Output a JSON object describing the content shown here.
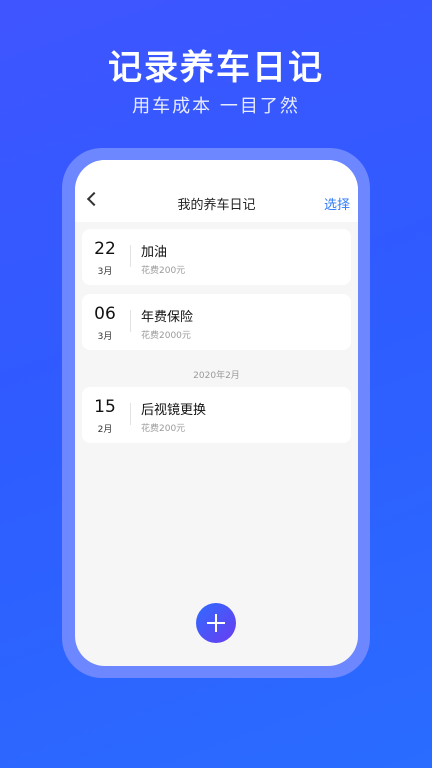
{
  "banner": {
    "headline": "记录养车日记",
    "subline": "用车成本 一目了然"
  },
  "app": {
    "title": "我的养车日记",
    "select_label": "选择"
  },
  "entries": [
    {
      "day": "22",
      "month": "3月",
      "title": "加油",
      "cost": "花费200元"
    },
    {
      "day": "06",
      "month": "3月",
      "title": "年费保险",
      "cost": "花费2000元"
    },
    {
      "day": "15",
      "month": "2月",
      "title": "后视镜更换",
      "cost": "花费200元"
    }
  ],
  "section_header": "2020年2月",
  "icons": {
    "back": "chevron-left-icon",
    "add": "plus-icon"
  },
  "colors": {
    "accent": "#2f7bff",
    "background": "#2f5bff"
  }
}
